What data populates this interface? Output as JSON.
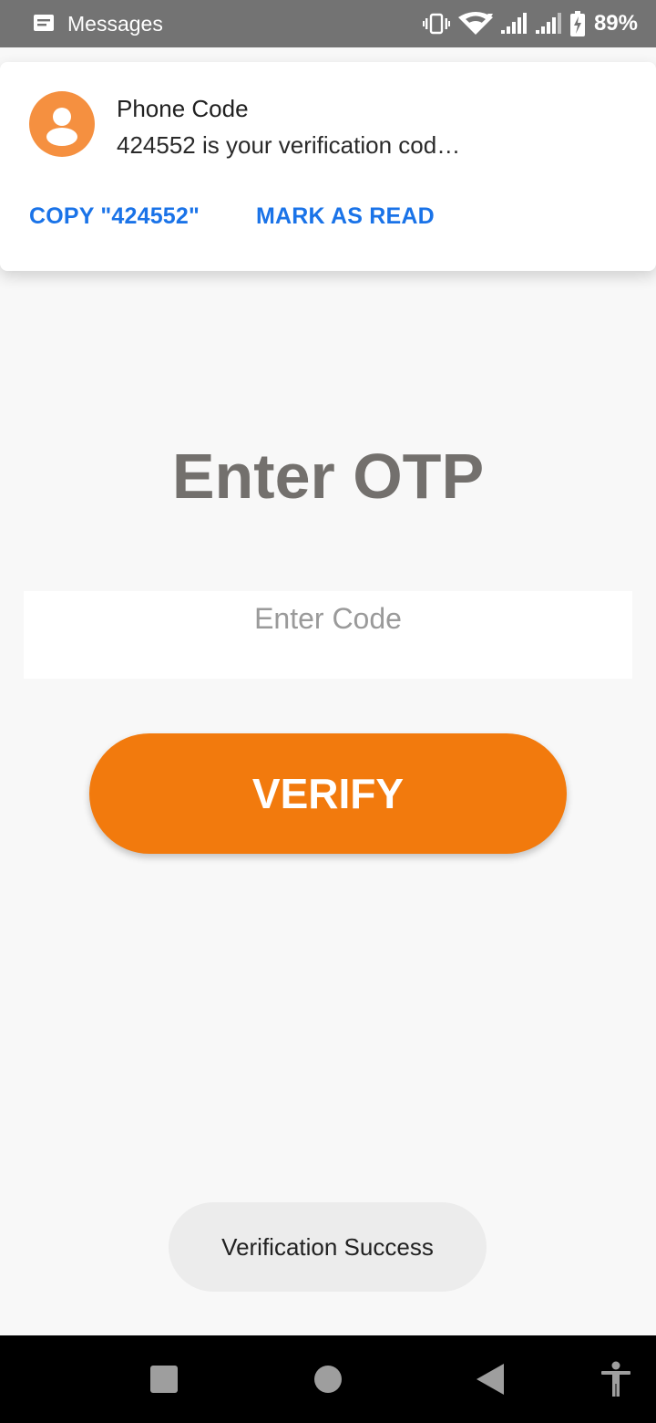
{
  "status_bar": {
    "app_name": "Messages",
    "battery_percent": "89%",
    "icons": [
      "messages-icon",
      "vibrate-icon",
      "wifi-icon",
      "signal-icon",
      "signal-icon",
      "battery-charging-icon"
    ]
  },
  "notification": {
    "title": "Phone Code",
    "body": "424552 is your verification cod…",
    "avatar_icon": "person-icon",
    "avatar_color": "#f59040",
    "actions": [
      {
        "label": "COPY \"424552\""
      },
      {
        "label": "MARK AS READ"
      }
    ],
    "action_color": "#1a73e8"
  },
  "main": {
    "heading": "Enter OTP",
    "code_input": {
      "placeholder": "Enter Code",
      "value": ""
    },
    "verify_button_label": "VERIFY",
    "accent_color": "#f27a0d"
  },
  "toast": {
    "message": "Verification Success"
  },
  "nav_bar": {
    "icons": [
      "recents-icon",
      "home-icon",
      "back-icon",
      "accessibility-icon"
    ]
  }
}
